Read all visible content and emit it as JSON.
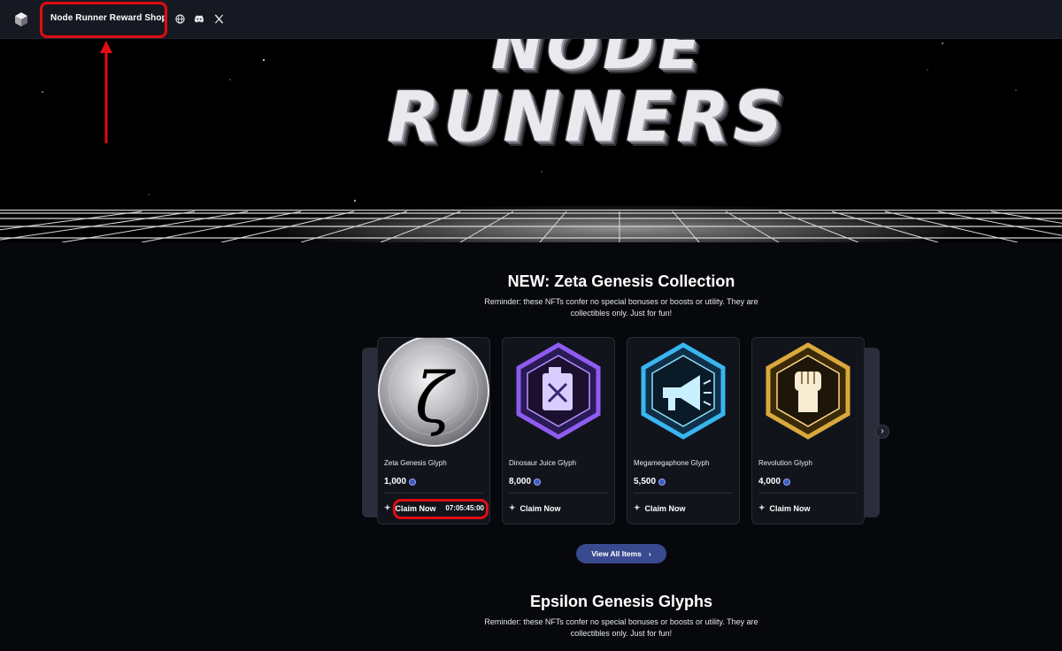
{
  "topbar": {
    "brand": "Node Runner Reward Shop",
    "icons": [
      "globe-icon",
      "discord-icon",
      "x-icon"
    ]
  },
  "hero": {
    "line1": "NODE",
    "line2": "RUNNERS"
  },
  "zeta": {
    "title": "NEW: Zeta Genesis Collection",
    "reminder_line1": "Reminder: these NFTs confer no special bonuses or boosts or utility. They are",
    "reminder_line2": "collectibles only. Just for fun!",
    "cards": [
      {
        "name": "Zeta Genesis Glyph",
        "price": "1,000",
        "claim": "Claim Now",
        "timer": "07:05:45:00",
        "glyph": "ζ"
      },
      {
        "name": "Dinosaur Juice Glyph",
        "price": "8,000",
        "claim": "Claim Now"
      },
      {
        "name": "Megamegaphone Glyph",
        "price": "5,500",
        "claim": "Claim Now"
      },
      {
        "name": "Revolution Glyph",
        "price": "4,000",
        "claim": "Claim Now"
      }
    ],
    "view_all": "View All Items",
    "next_arrow": "›"
  },
  "epsilon": {
    "title": "Epsilon Genesis Glyphs",
    "reminder_line1": "Reminder: these NFTs confer no special bonuses or boosts or utility. They are",
    "reminder_line2": "collectibles only. Just for fun!"
  },
  "colors": {
    "background": "#07080c",
    "topbar": "#161922",
    "card": "#12141c",
    "accent_button": "#3a4a8e",
    "annotation": "#e00d12",
    "purple": "#7b4bd8",
    "cyan": "#39b6f0",
    "gold": "#d9a93c"
  }
}
